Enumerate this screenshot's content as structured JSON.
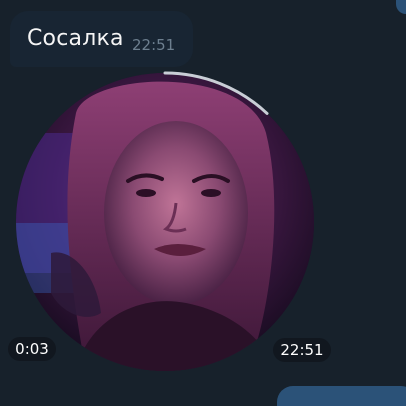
{
  "message": {
    "text": "Сосалка",
    "time": "22:51"
  },
  "video_note": {
    "duration": "0:03",
    "time": "22:51",
    "progress": 0.12
  },
  "colors": {
    "background": "#17212b",
    "incoming_bubble": "#182533",
    "outgoing_bubble": "#2b5278",
    "progress_ring": "#c9ced6"
  }
}
